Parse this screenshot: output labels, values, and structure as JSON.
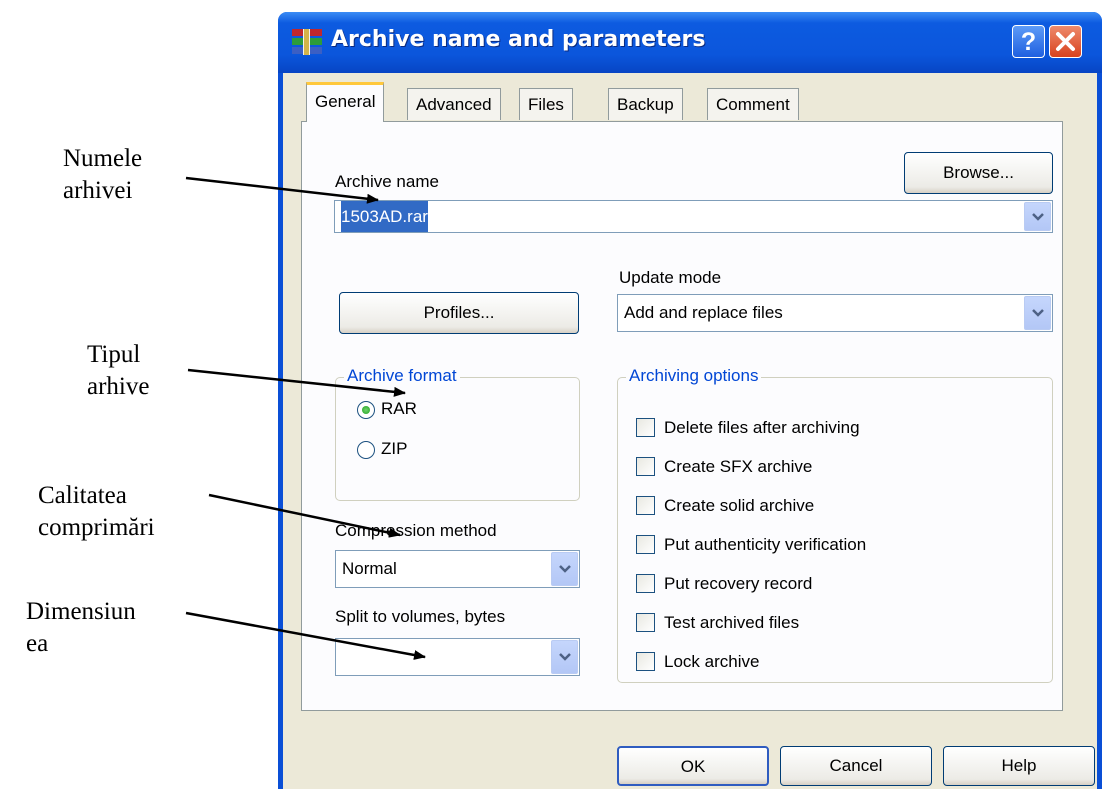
{
  "annotations": {
    "archive_name": [
      "Numele",
      "arhivei"
    ],
    "archive_type": [
      "Tipul",
      "arhive"
    ],
    "compression": [
      "Calitatea",
      "comprimări"
    ],
    "size": [
      "Dimensiun",
      "ea"
    ]
  },
  "window": {
    "title": "Archive name and parameters",
    "help_label": "?",
    "close_label": "X"
  },
  "tabs": [
    "General",
    "Advanced",
    "Files",
    "Backup",
    "Comment"
  ],
  "general": {
    "archive_name_label": "Archive name",
    "browse_label": "Browse...",
    "archive_name_value": "1503AD.rar",
    "update_mode_label": "Update mode",
    "update_mode_value": "Add and replace files",
    "profiles_label": "Profiles...",
    "archive_format": {
      "legend": "Archive format",
      "options": [
        "RAR",
        "ZIP"
      ],
      "selected": "RAR"
    },
    "compression_method_label": "Compression method",
    "compression_method_value": "Normal",
    "split_label": "Split to volumes, bytes",
    "split_value": "",
    "archiving_options": {
      "legend": "Archiving options",
      "items": [
        "Delete files after archiving",
        "Create SFX archive",
        "Create solid archive",
        "Put authenticity verification",
        "Put recovery record",
        "Test archived files",
        "Lock archive"
      ]
    }
  },
  "buttons": {
    "ok": "OK",
    "cancel": "Cancel",
    "help": "Help"
  }
}
